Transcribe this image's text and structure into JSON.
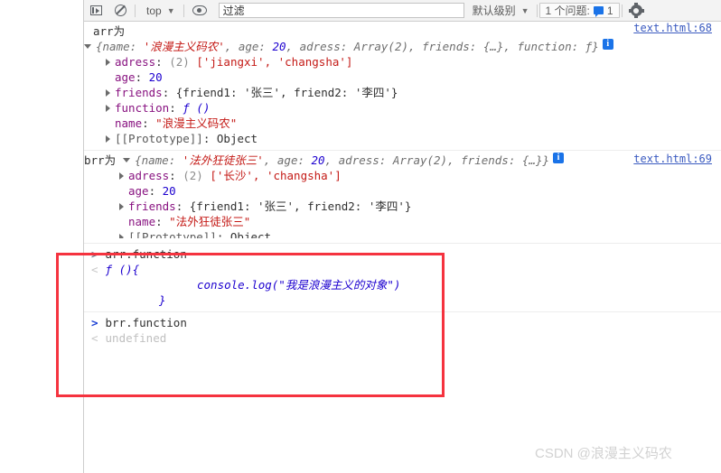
{
  "toolbar": {
    "panel_icon": "sidebar-panel-icon",
    "clear_icon": "clear-console-icon",
    "context_label": "top",
    "eye_icon": "eye-icon",
    "filter_placeholder": "过滤",
    "filter_value": "",
    "level_label": "默认级别",
    "issues_label": "1 个问题:",
    "issues_count": "1",
    "gear_icon": "gear-icon"
  },
  "console": {
    "entries": [
      {
        "log_label": "arr为",
        "source": "text.html:68",
        "preview": {
          "open_brace": "{",
          "name_key": "name: ",
          "name_val": "'浪漫主义码农'",
          "sep1": ", ",
          "age_key": "age: ",
          "age_val": "20",
          "sep2": ", ",
          "adress_key": "adress: ",
          "adress_val": "Array(2)",
          "sep3": ", ",
          "friends_key": "friends: ",
          "friends_val": "{…}",
          "sep4": ", ",
          "function_key": "function: ",
          "function_val": "ƒ",
          "close_brace": "}"
        },
        "props": [
          {
            "key": "adress",
            "count": "(2)",
            "value": "['jiangxi', 'changsha']"
          },
          {
            "key": "age",
            "value": "20"
          },
          {
            "key": "friends",
            "value": "{friend1: '张三', friend2: '李四'}"
          },
          {
            "key": "function",
            "value": "ƒ ()"
          },
          {
            "key": "name",
            "value": "\"浪漫主义码农\""
          },
          {
            "key": "[[Prototype]]",
            "value": "Object"
          }
        ]
      },
      {
        "log_label": "brr为",
        "source": "text.html:69",
        "preview": {
          "open_brace": "{",
          "name_key": "name: ",
          "name_val": "'法外狂徒张三'",
          "sep1": ", ",
          "age_key": "age: ",
          "age_val": "20",
          "sep2": ", ",
          "adress_key": "adress: ",
          "adress_val": "Array(2)",
          "sep3": ", ",
          "friends_key": "friends: ",
          "friends_val": "{…}",
          "close_brace": "}"
        },
        "props": [
          {
            "key": "adress",
            "count": "(2)",
            "value": "['长沙', 'changsha']"
          },
          {
            "key": "age",
            "value": "20"
          },
          {
            "key": "friends",
            "value": "{friend1: '张三', friend2: '李四'}"
          },
          {
            "key": "name",
            "value": "\"法外狂徒张三\""
          },
          {
            "key": "[[Prototype]]",
            "value": "Object"
          }
        ]
      }
    ],
    "commands": [
      {
        "input": "arr.function",
        "output_line1": "ƒ (){",
        "output_line2": "console.log(\"我是浪漫主义的对象\")",
        "output_line3": "}"
      },
      {
        "input": "brr.function",
        "output": "undefined"
      }
    ]
  },
  "watermark": "CSDN @浪漫主义码农",
  "accent": {
    "red_box": "#f5333f",
    "link": "#3b5bc0",
    "info": "#1a73e8"
  }
}
